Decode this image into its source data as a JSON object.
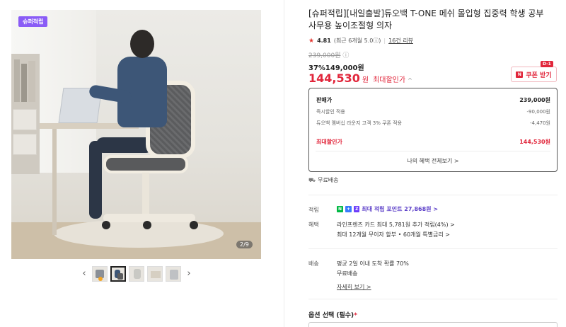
{
  "gallery": {
    "badge": "슈퍼적립",
    "counter": "2/9",
    "prev_arrow": "‹",
    "next_arrow": "›",
    "thumb_count": 5
  },
  "product": {
    "title": "[슈퍼적립][내일출발]듀오백 T-ONE 메쉬 몰입형 집중력 학생 공부 사무용 높이조절형 의자",
    "rating_score": "4.81",
    "rating_detail": "(최근 6개월 5.0ⓘ)",
    "review_link": "16건 리뷰"
  },
  "pricing": {
    "original_price": "239,000원",
    "info_mark": "ⓘ",
    "discount_line": "37%149,000원",
    "best_price": "144,530",
    "best_unit": "원",
    "best_label": "최대할인가",
    "best_chevron": "^",
    "coupon_label": "쿠폰 받기",
    "coupon_icon": "N",
    "dday": "D-1"
  },
  "price_box": {
    "header_label": "판매가",
    "header_value": "239,000원",
    "rows": [
      {
        "label": "즉시할인 적용",
        "value": "-90,000원"
      },
      {
        "label": "듀오백 멤버십 라운지 고객 3% 쿠폰 적용",
        "value": "-4,470원"
      }
    ],
    "best_label": "최대할인가",
    "best_value": "144,530원",
    "more_link": "나의 혜택 전체보기 >"
  },
  "shipping_summary": {
    "icon": "truck-icon",
    "text": "무료배송"
  },
  "info": {
    "points_label": "적립",
    "points_badges": [
      "N",
      "+",
      "Z"
    ],
    "points_text": "최대 적립 포인트 27,868원 >",
    "benefit_label": "혜택",
    "benefit_line1": "라인프렌즈 카드 최대 5,781원 추가 적립(4%) >",
    "benefit_line2": "최대 12개월 무이자 할부 • 60개월 특별금리 >",
    "delivery_label": "배송",
    "delivery_line1": "평균 2일 이내 도착 확률 70%",
    "delivery_line2": "무료배송",
    "delivery_more": "자세히 보기 >"
  },
  "options": {
    "title": "옵션 선택 (필수)",
    "required_mark": "*"
  },
  "colors": {
    "accent_red": "#e1263b",
    "super_badge": "#8a5cf6",
    "naver_green": "#00b843"
  }
}
